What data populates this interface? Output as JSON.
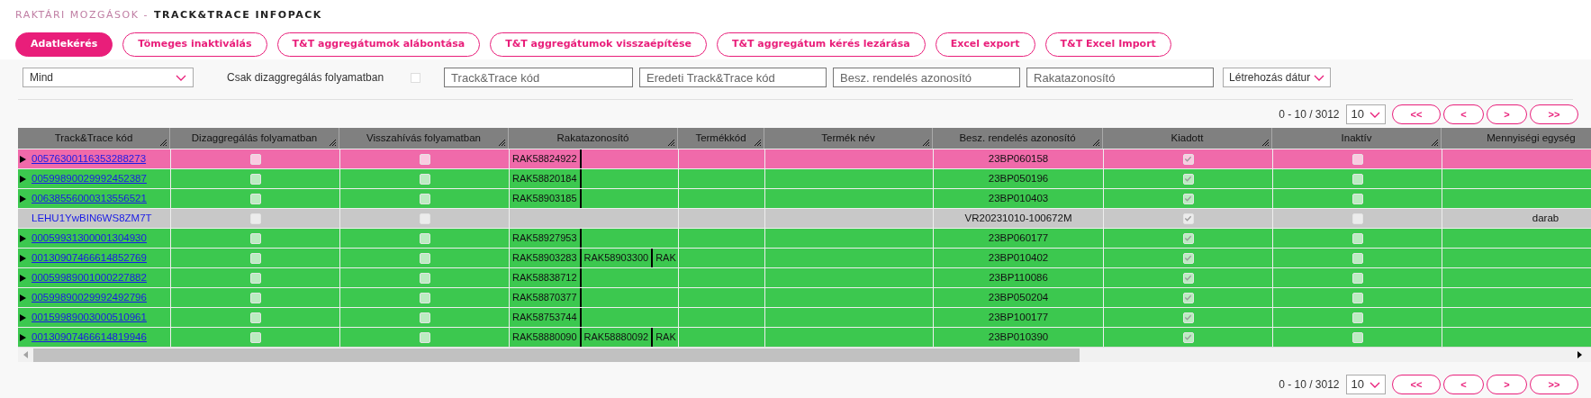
{
  "breadcrumb": {
    "section": "RAKTÁRI MOZGÁSOK -",
    "title": "TRACK&TRACE INFOPACK"
  },
  "actions": [
    {
      "label": "Adatlekérés",
      "selected": true
    },
    {
      "label": "Tömeges inaktiválás",
      "selected": false
    },
    {
      "label": "T&T aggregátumok alábontása",
      "selected": false
    },
    {
      "label": "T&T aggregátumok visszaépítése",
      "selected": false
    },
    {
      "label": "T&T aggregátum kérés lezárása",
      "selected": false
    },
    {
      "label": "Excel export",
      "selected": false
    },
    {
      "label": "T&T Excel Import",
      "selected": false
    }
  ],
  "filters": {
    "status_select": "Mind",
    "only_disaggregating_label": "Csak dizaggregálás folyamatban",
    "only_disaggregating_checked": false,
    "fields": [
      {
        "placeholder": "Track&Trace kód"
      },
      {
        "placeholder": "Eredeti Track&Trace kód"
      },
      {
        "placeholder": "Besz. rendelés azonosító"
      },
      {
        "placeholder": "Rakatazonosító"
      }
    ],
    "date_select": "Létrehozás dátur"
  },
  "pagination_top": {
    "range": "0 - 10 / 3012",
    "page_size": "10",
    "buttons": [
      "<<",
      "<",
      ">",
      ">>"
    ]
  },
  "table": {
    "columns": [
      "Track&Trace kód",
      "Dizaggregálás folyamatban",
      "Visszahívás folyamatban",
      "Rakatazonosító",
      "Termékkód",
      "Termék név",
      "Besz. rendelés azonosító",
      "Kiadott",
      "Inaktív",
      "Mennyiségi egység"
    ],
    "rows": [
      {
        "color": "#f06aaa",
        "expandable": true,
        "code": "00576300116353288273",
        "disaggregating": false,
        "recall": false,
        "pallets": [
          "RAK58824922"
        ],
        "order": "23BP060158",
        "issued": true,
        "inactive": false
      },
      {
        "color": "#3cc84f",
        "expandable": true,
        "code": "00599890029992452387",
        "disaggregating": false,
        "recall": false,
        "pallets": [
          "RAK58820184"
        ],
        "order": "23BP050196",
        "issued": true,
        "inactive": false
      },
      {
        "color": "#3cc84f",
        "expandable": true,
        "code": "00638556000313556521",
        "disaggregating": false,
        "recall": false,
        "pallets": [
          "RAK58903185"
        ],
        "order": "23BP010403",
        "issued": true,
        "inactive": false
      },
      {
        "color": "#c8c8c8",
        "expandable": false,
        "code": "LEHU1YwBIN6WS8ZM7T",
        "disaggregating": false,
        "recall": false,
        "pallets": [],
        "order": "VR20231010-100672M",
        "issued": true,
        "inactive": false,
        "unit": "darab"
      },
      {
        "color": "#3cc84f",
        "expandable": true,
        "code": "00059931300001304930",
        "disaggregating": false,
        "recall": false,
        "pallets": [
          "RAK58927953"
        ],
        "order": "23BP060177",
        "issued": true,
        "inactive": false
      },
      {
        "color": "#3cc84f",
        "expandable": true,
        "code": "00130907466614852769",
        "disaggregating": false,
        "recall": false,
        "pallets": [
          "RAK58903283",
          "RAK58903300",
          "RAK"
        ],
        "order": "23BP010402",
        "issued": true,
        "inactive": false
      },
      {
        "color": "#3cc84f",
        "expandable": true,
        "code": "00059989001000227882",
        "disaggregating": false,
        "recall": false,
        "pallets": [
          "RAK58838712"
        ],
        "order": "23BP110086",
        "issued": true,
        "inactive": false
      },
      {
        "color": "#3cc84f",
        "expandable": true,
        "code": "00599890029992492796",
        "disaggregating": false,
        "recall": false,
        "pallets": [
          "RAK58870377"
        ],
        "order": "23BP050204",
        "issued": true,
        "inactive": false
      },
      {
        "color": "#3cc84f",
        "expandable": true,
        "code": "00159989003000510961",
        "disaggregating": false,
        "recall": false,
        "pallets": [
          "RAK58753744"
        ],
        "order": "23BP100177",
        "issued": true,
        "inactive": false
      },
      {
        "color": "#3cc84f",
        "expandable": true,
        "code": "00130907466614819946",
        "disaggregating": false,
        "recall": false,
        "pallets": [
          "RAK58880090",
          "RAK58880092",
          "RAK"
        ],
        "order": "23BP010390",
        "issued": true,
        "inactive": false
      }
    ]
  },
  "pagination_bottom": {
    "range": "0 - 10 / 3012",
    "page_size": "10",
    "buttons": [
      "<<",
      "<",
      ">",
      ">>"
    ]
  }
}
